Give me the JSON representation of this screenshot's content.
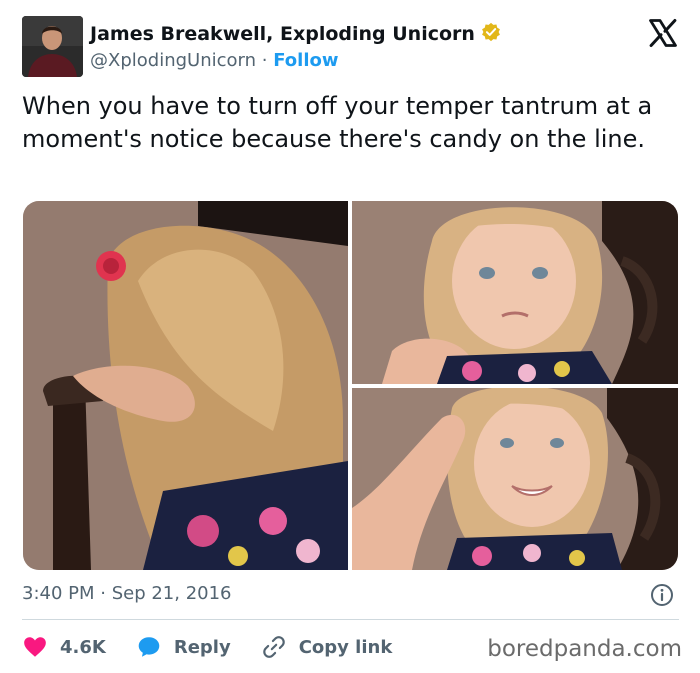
{
  "tweet": {
    "author_name": "James Breakwell, Exploding Unicorn",
    "handle": "@XplodingUnicorn",
    "separator": "·",
    "follow_label": "Follow",
    "text": "When you have to turn off your temper tantrum at a moment's notice because there's candy on the line.",
    "timestamp": "3:40 PM · Sep 21, 2016"
  },
  "actions": {
    "like_count": "4.6K",
    "reply_label": "Reply",
    "copy_link_label": "Copy link"
  },
  "source_watermark": "boredpanda.com",
  "icons": [
    "verified-badge-icon",
    "x-logo-icon",
    "info-icon",
    "heart-icon",
    "reply-bubble-icon",
    "link-icon"
  ],
  "colors": {
    "accent": "#1d9bf0",
    "like": "#f91880",
    "verified": "#e2b719",
    "text": "#0f1419",
    "muted": "#536471"
  }
}
